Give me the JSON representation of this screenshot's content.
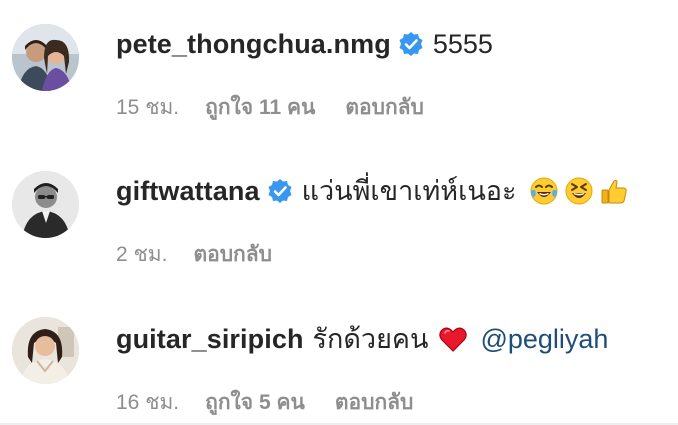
{
  "comments": [
    {
      "username": "pete_thongchua.nmg",
      "verified": true,
      "text": "5555",
      "time": "15 ชม.",
      "likes": "ถูกใจ 11 คน",
      "reply": "ตอบกลับ",
      "emojis": []
    },
    {
      "username": "giftwattana",
      "verified": true,
      "text": "แว่นพี่เขาเท่ห์เนอะ",
      "time": "2 ชม.",
      "likes": "",
      "reply": "ตอบกลับ",
      "emojis": [
        "face-with-tears-of-joy",
        "grinning-squinting-face",
        "thumbs-up"
      ]
    },
    {
      "username": "guitar_siripich",
      "verified": false,
      "text": "รักด้วยคน",
      "mention": "@pegliyah",
      "time": "16 ชม.",
      "likes": "ถูกใจ 5 คน",
      "reply": "ตอบกลับ",
      "emojis": [
        "red-heart"
      ]
    }
  ],
  "colors": {
    "verified": "#3897f0",
    "mention": "#1f4d7a",
    "meta": "#8e8e8e",
    "text": "#262626"
  }
}
